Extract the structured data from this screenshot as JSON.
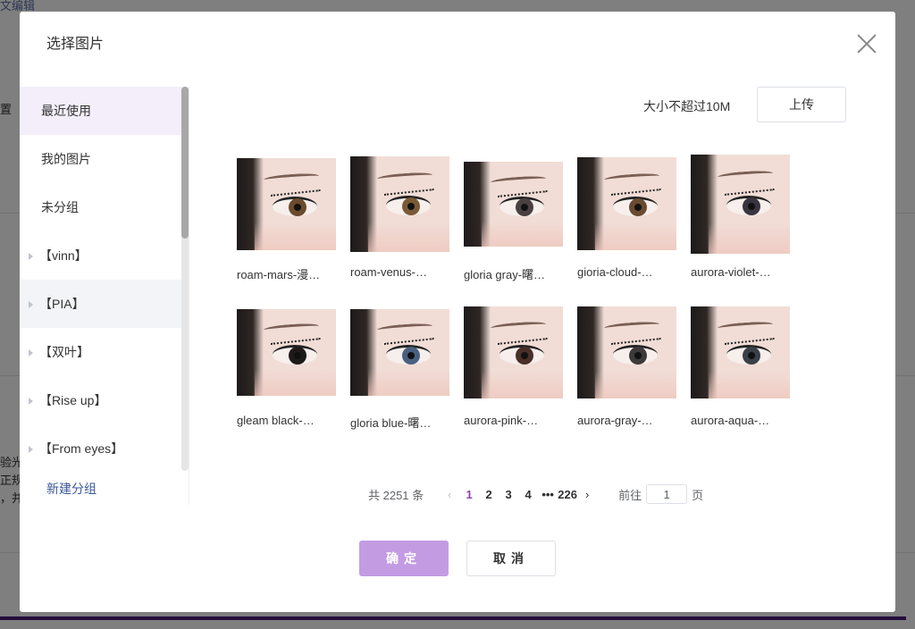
{
  "background": {
    "top_link": "文编辑",
    "left_label": "置",
    "left_text_lines": [
      "验光",
      "正规",
      "，并"
    ]
  },
  "modal": {
    "title": "选择图片",
    "sidebar": {
      "items": [
        {
          "label": "最近使用",
          "active": true
        },
        {
          "label": "我的图片"
        },
        {
          "label": "未分组"
        },
        {
          "label": "【vinn】",
          "group": true
        },
        {
          "label": "【PIA】",
          "group": true
        },
        {
          "label": "【双叶】",
          "group": true
        },
        {
          "label": "【Rise up】",
          "group": true
        },
        {
          "label": "【From eyes】",
          "group": true
        }
      ],
      "new_group": "新建分组"
    },
    "upload": {
      "hint": "大小不超过10M",
      "button": "上传"
    },
    "images": [
      {
        "caption": "roam-mars-漫…",
        "iris": "#6b4a2e"
      },
      {
        "caption": "roam-venus-…",
        "iris": "#7a5a36"
      },
      {
        "caption": "gloria gray-曙…",
        "iris": "#4a4040"
      },
      {
        "caption": "gioria-cloud-…",
        "iris": "#6a4a30"
      },
      {
        "caption": "aurora-violet-…",
        "iris": "#3a3440"
      },
      {
        "caption": "gleam black-…",
        "iris": "#1f1a1a"
      },
      {
        "caption": "gloria blue-曙…",
        "iris": "#4a6080"
      },
      {
        "caption": "aurora-pink-…",
        "iris": "#4a2e28"
      },
      {
        "caption": "aurora-gray-…",
        "iris": "#3e3a3a"
      },
      {
        "caption": "aurora-aqua-…",
        "iris": "#3a4048"
      }
    ],
    "pagination": {
      "total": "共 2251 条",
      "prev": "‹",
      "pages": [
        "1",
        "2",
        "3",
        "4"
      ],
      "ellipsis": "•••",
      "last": "226",
      "next": "›",
      "goto_label": "前往",
      "goto_value": "1",
      "goto_suffix": "页",
      "current": "1"
    },
    "buttons": {
      "ok": "确定",
      "cancel": "取消"
    }
  }
}
